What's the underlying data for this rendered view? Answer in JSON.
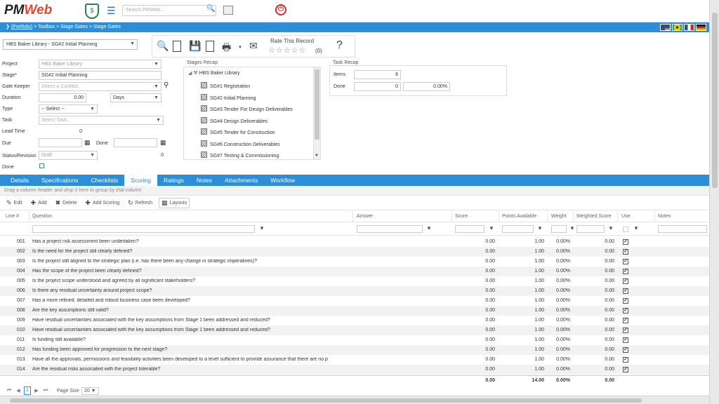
{
  "app": {
    "logo_pm": "PM",
    "logo_web": "Web",
    "shield_text": "$",
    "search_placeholder": "Search PMWeb...",
    "breadcrumb": {
      "first": "(Portfolio)",
      "rest": " > Toolbox > Stage Gates > Stage Gates"
    },
    "icons": {
      "shield": "shield-icon",
      "menu": "hamburger-menu-icon",
      "search": "search-icon",
      "media": "film-icon",
      "power": "power-icon"
    },
    "flags": [
      "us-flag",
      "brazil-flag",
      "france-flag",
      "germany-flag"
    ],
    "colors": {
      "accent": "#2b8ed6",
      "power": "#d12b1f",
      "logo_accent": "#e04b2f",
      "shield": "#2e7d5b"
    }
  },
  "record": {
    "selected": "HBS Baker Library - SG#2 Initial Planning",
    "rate_title": "Rate This Record",
    "rate_count": "(0)",
    "toolbar_icons": [
      "search-icon",
      "new-document-icon",
      "save-icon",
      "save-close-icon",
      "print-icon",
      "email-icon",
      "help-icon"
    ]
  },
  "form": {
    "labels": {
      "project": "Project",
      "stage": "Stage*",
      "gate_keeper": "Gate Keeper",
      "duration": "Duration",
      "type": "Type",
      "task": "Task",
      "lead_time": "Lead Time",
      "due": "Due",
      "done_date": "Done",
      "status": "Status/Revision",
      "done": "Done"
    },
    "values": {
      "project": "HBS Baker Library",
      "stage": "SG#2 Initial Planning",
      "gate_keeper": "Select a Contact...",
      "duration": "0.00",
      "duration_unit": "Days",
      "type": "-- Select --",
      "task": "Select Task...",
      "lead_time": "0",
      "status": "Draft",
      "revision": "0"
    }
  },
  "stages_recap": {
    "title": "Stages Recap",
    "root": "HBS Baker Library",
    "items": [
      "SG#1 Registration",
      "SG#2 Initial Planning",
      "SG#3 Tender For Design Deliverables",
      "SG#4 Design Deliverables",
      "SG#5 Tender for Construction",
      "SG#6 Construction Deliverables",
      "SG#7 Testing & Commissioning"
    ]
  },
  "task_recap": {
    "title": "Task Recap",
    "items_label": "Items",
    "items_value": "8",
    "done_label": "Done",
    "done_value": "0",
    "done_pct": "0.00%"
  },
  "tabs": [
    "Details",
    "Specifications",
    "Checklists",
    "Scoring",
    "Ratings",
    "Notes",
    "Attachments",
    "Workflow"
  ],
  "active_tab": 3,
  "grid": {
    "group_hint": "Drag a column header and drop it here to group by that column",
    "toolbar": {
      "edit": "Edit",
      "add": "Add",
      "delete": "Delete",
      "add_scoring": "Add Scoring",
      "refresh": "Refresh",
      "layouts": "Layouts"
    },
    "columns": {
      "line": "Line #",
      "question": "Question",
      "answer": "Answer",
      "score": "Score",
      "points": "Points Available",
      "weight": "Weight",
      "weighted": "Weighted Score",
      "use": "Use",
      "notes": "Notes"
    },
    "rows": [
      {
        "line": "001",
        "question": "Has a project risk assessment been undertaken?",
        "score": "0.00",
        "points": "1.00",
        "weight": "0.00%",
        "weighted": "0.00"
      },
      {
        "line": "002",
        "question": "Is the need for the project still clearly defined?",
        "score": "0.00",
        "points": "1.00",
        "weight": "0.00%",
        "weighted": "0.00"
      },
      {
        "line": "003",
        "question": "Is the project still aligned to the strategic plan (i.e. has there been any change in strategic imperatives)?",
        "score": "0.00",
        "points": "1.00",
        "weight": "0.00%",
        "weighted": "0.00"
      },
      {
        "line": "004",
        "question": "Has the scope of the project been clearly defined?",
        "score": "0.00",
        "points": "1.00",
        "weight": "0.00%",
        "weighted": "0.00"
      },
      {
        "line": "005",
        "question": "Is the project scope understood and agreed by all significant stakeholders?",
        "score": "0.00",
        "points": "1.00",
        "weight": "0.00%",
        "weighted": "0.00"
      },
      {
        "line": "006",
        "question": "Is there any residual uncertainty around project scope?",
        "score": "0.00",
        "points": "1.00",
        "weight": "0.00%",
        "weighted": "0.00"
      },
      {
        "line": "007",
        "question": "Has a more refined, detailed and robust business case been developed?",
        "score": "0.00",
        "points": "1.00",
        "weight": "0.00%",
        "weighted": "0.00"
      },
      {
        "line": "008",
        "question": "Are the key assumptions still valid?",
        "score": "0.00",
        "points": "1.00",
        "weight": "0.00%",
        "weighted": "0.00"
      },
      {
        "line": "009",
        "question": "Have residual uncertainties associated with the key assumptions from Stage 1 been addressed and reduced?",
        "score": "0.00",
        "points": "1.00",
        "weight": "0.00%",
        "weighted": "0.00"
      },
      {
        "line": "010",
        "question": "Have residual uncertainties associated with the key assumptions from Stage 1 been addressed and reduced?",
        "score": "0.00",
        "points": "1.00",
        "weight": "0.00%",
        "weighted": "0.00"
      },
      {
        "line": "011",
        "question": "Is funding still available?",
        "score": "0.00",
        "points": "1.00",
        "weight": "0.00%",
        "weighted": "0.00"
      },
      {
        "line": "012",
        "question": "Has funding been approved for progression to the next stage?",
        "score": "0.00",
        "points": "1.00",
        "weight": "0.00%",
        "weighted": "0.00"
      },
      {
        "line": "013",
        "question": "Have all the approvals, permissions and feasibility activities been developed to a level sufficient to provide assurance that there are no p",
        "score": "0.00",
        "points": "1.00",
        "weight": "0.00%",
        "weighted": "0.00"
      },
      {
        "line": "014",
        "question": "Are the residual risks associated with the project tolerable?",
        "score": "0.00",
        "points": "1.00",
        "weight": "0.00%",
        "weighted": "0.00"
      }
    ],
    "totals": {
      "score": "0.00",
      "points": "14.00",
      "weight": "0.00%",
      "weighted": "0.00"
    },
    "pager": {
      "current": "1",
      "size_label": "Page Size",
      "size": "20"
    }
  }
}
